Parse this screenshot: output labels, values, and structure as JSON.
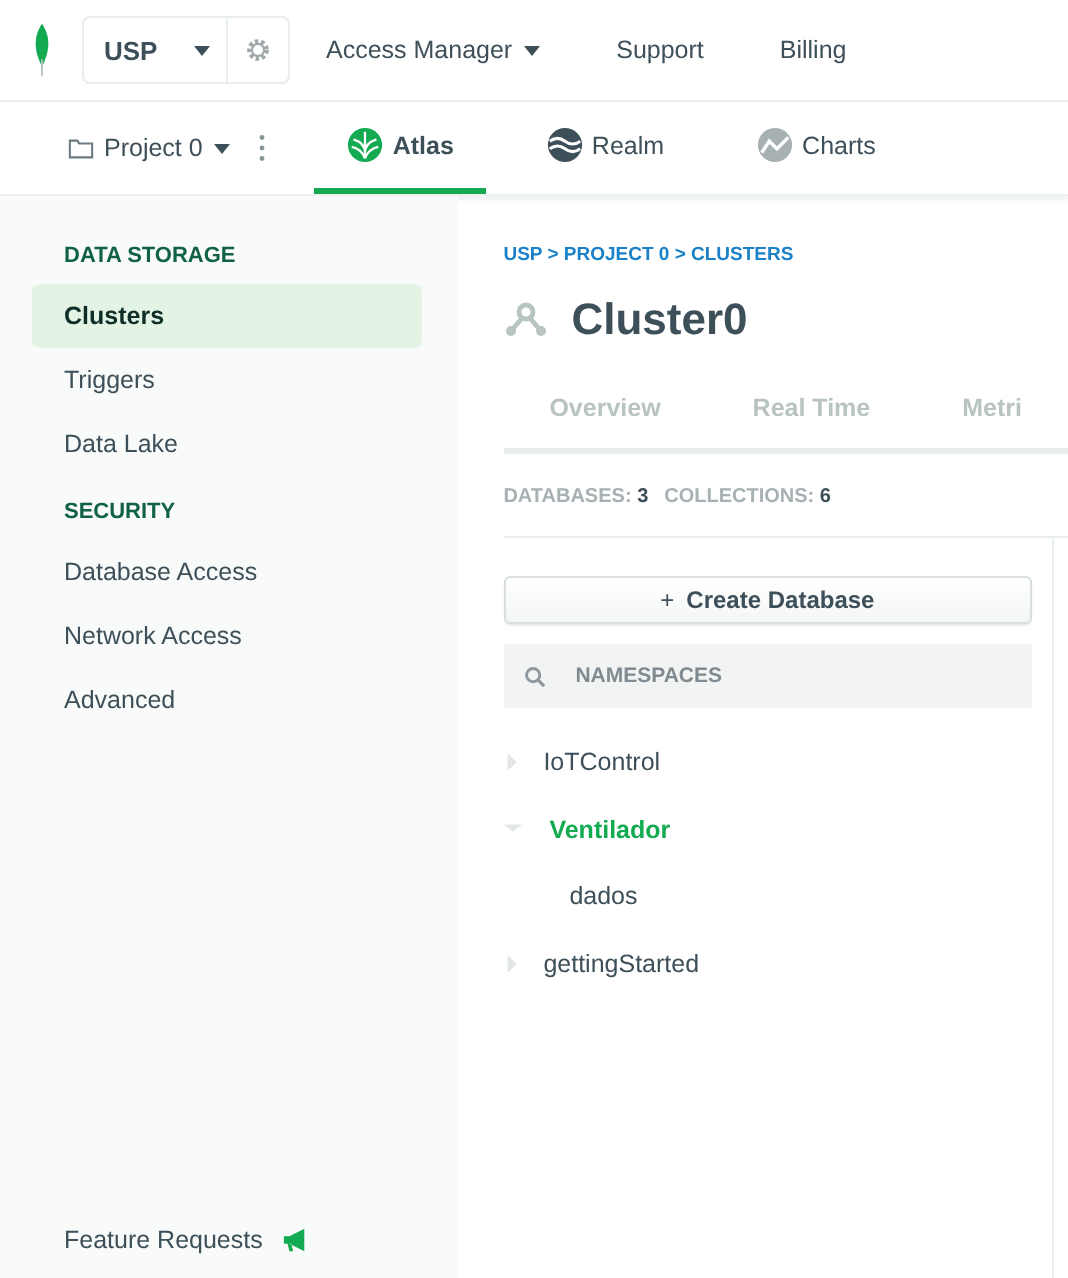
{
  "top_bar": {
    "organization": "USP",
    "menus": [
      {
        "label": "Access Manager",
        "dropdown": true
      },
      {
        "label": "Support",
        "dropdown": false
      },
      {
        "label": "Billing",
        "dropdown": false
      }
    ]
  },
  "project_bar": {
    "project": "Project 0",
    "apps": [
      {
        "label": "Atlas",
        "kind": "atlas",
        "selected": true
      },
      {
        "label": "Realm",
        "kind": "realm",
        "selected": false
      },
      {
        "label": "Charts",
        "kind": "charts",
        "selected": false
      }
    ]
  },
  "sidebar": {
    "sections": [
      {
        "title": "DATA STORAGE",
        "items": [
          {
            "label": "Clusters",
            "selected": true
          },
          {
            "label": "Triggers",
            "selected": false
          },
          {
            "label": "Data Lake",
            "selected": false
          }
        ]
      },
      {
        "title": "SECURITY",
        "items": [
          {
            "label": "Database Access",
            "selected": false
          },
          {
            "label": "Network Access",
            "selected": false
          },
          {
            "label": "Advanced",
            "selected": false
          }
        ]
      }
    ],
    "footer": "Feature Requests"
  },
  "breadcrumb": "USP > PROJECT 0 > CLUSTERS",
  "cluster_title": "Cluster0",
  "tabs": [
    {
      "label": "Overview"
    },
    {
      "label": "Real Time"
    },
    {
      "label": "Metri"
    }
  ],
  "stats": [
    {
      "label": "DATABASES:",
      "value": "3"
    },
    {
      "label": "COLLECTIONS:",
      "value": "6"
    }
  ],
  "create_button": {
    "icon": "+",
    "label": "Create Database"
  },
  "search": {
    "placeholder": "NAMESPACES"
  },
  "databases": [
    {
      "name": "IoTControl",
      "expanded": false
    },
    {
      "name": "Ventilador",
      "expanded": true,
      "children": [
        {
          "name": "dados"
        }
      ]
    },
    {
      "name": "gettingStarted",
      "expanded": false
    }
  ]
}
